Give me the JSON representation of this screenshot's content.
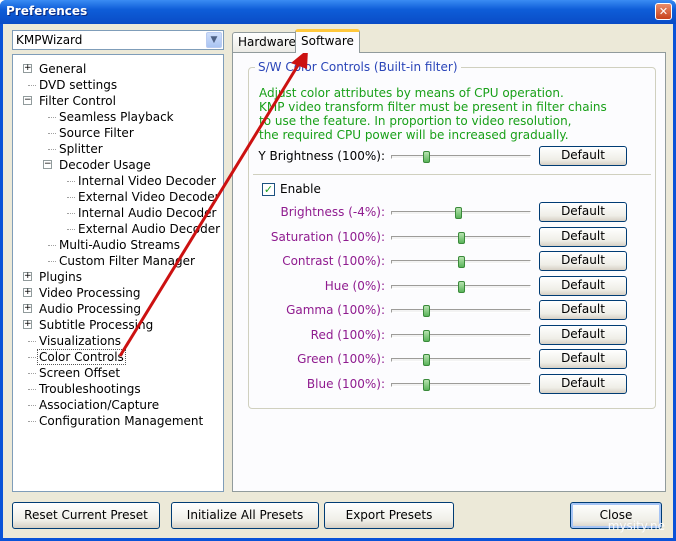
{
  "window": {
    "title": "Preferences",
    "close_glyph": "✕"
  },
  "preset": {
    "value": "KMPWizard"
  },
  "tree": [
    {
      "label": "General",
      "expander": "+"
    },
    {
      "label": "DVD settings"
    },
    {
      "label": "Filter Control",
      "expander": "−"
    },
    {
      "label": "Seamless Playback"
    },
    {
      "label": "Source Filter"
    },
    {
      "label": "Splitter"
    },
    {
      "label": "Decoder Usage",
      "expander": "−"
    },
    {
      "label": "Internal Video Decoder"
    },
    {
      "label": "External Video Decoder"
    },
    {
      "label": "Internal Audio Decoder"
    },
    {
      "label": "External Audio Decoder"
    },
    {
      "label": "Multi-Audio Streams"
    },
    {
      "label": "Custom Filter Manager"
    },
    {
      "label": "Plugins",
      "expander": "+"
    },
    {
      "label": "Video Processing",
      "expander": "+"
    },
    {
      "label": "Audio Processing",
      "expander": "+"
    },
    {
      "label": "Subtitle Processing",
      "expander": "+"
    },
    {
      "label": "Visualizations"
    },
    {
      "label": "Color Controls",
      "selected": true
    },
    {
      "label": "Screen Offset"
    },
    {
      "label": "Troubleshootings"
    },
    {
      "label": "Association/Capture"
    },
    {
      "label": "Configuration Management"
    }
  ],
  "tabs": {
    "hardware": "Hardware",
    "software": "Software"
  },
  "group": {
    "title": "S/W Color Controls (Built-in filter)",
    "desc": [
      "Adjust color attributes by means of CPU operation.",
      "KMP video transform filter must be present in filter chains",
      "to use the feature. In proportion to video resolution,",
      "the required CPU power will be increased gradually."
    ],
    "y_brightness": {
      "label": "Y Brightness (100%):",
      "level": 0.25
    },
    "enable_label": "Enable",
    "enable_checked": true,
    "default_label": "Default",
    "sliders": [
      {
        "label": "Brightness (-4%):",
        "level": 0.48
      },
      {
        "label": "Saturation (100%):",
        "level": 0.5
      },
      {
        "label": "Contrast (100%):",
        "level": 0.5
      },
      {
        "label": "Hue (0%):",
        "level": 0.5
      },
      {
        "label": "Gamma (100%):",
        "level": 0.25
      },
      {
        "label": "Red (100%):",
        "level": 0.25
      },
      {
        "label": "Green (100%):",
        "level": 0.25
      },
      {
        "label": "Blue (100%):",
        "level": 0.25
      }
    ]
  },
  "buttons": {
    "reset": "Reset Current Preset",
    "initialize": "Initialize All Presets",
    "export": "Export Presets",
    "close": "Close"
  },
  "watermark": "mysity.ne",
  "colors": {
    "annotation_arrow": "#CC1111",
    "group_title": "#2A45B8",
    "description": "#19A019",
    "slider_label": "#8F1B8F"
  }
}
